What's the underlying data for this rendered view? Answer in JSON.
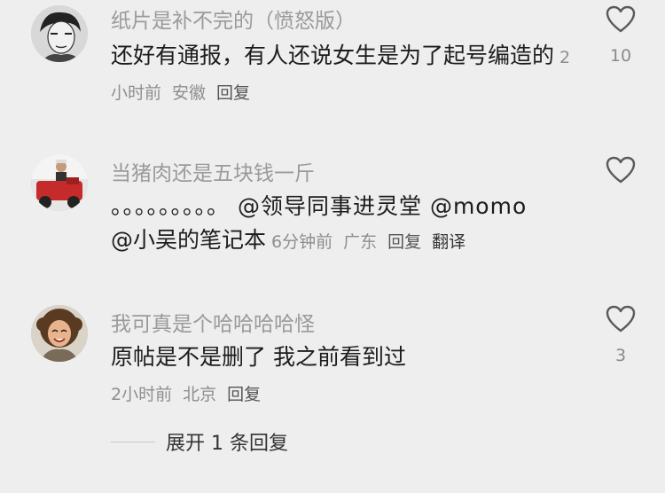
{
  "comments": [
    {
      "username": "纸片是补不完的（愤怒版）",
      "text": "还好有通报，有人还说女生是为了起号编造的",
      "time": "2小时前",
      "location": "安徽",
      "reply_label": "回复",
      "like_count": "10",
      "avatar_icon": "sketch-portrait-avatar"
    },
    {
      "username": "当猪肉还是五块钱一斤",
      "text_prefix": "。。。。。。。。。",
      "mentions": [
        "@领导同事进灵堂",
        "@momo",
        "@小吴的笔记本"
      ],
      "time": "6分钟前",
      "location": "广东",
      "reply_label": "回复",
      "translate_label": "翻译",
      "like_count": "",
      "avatar_icon": "person-with-red-motorbike-avatar"
    },
    {
      "username": "我可真是个哈哈哈哈怪",
      "text": "原帖是不是删了 我之前看到过",
      "time": "2小时前",
      "location": "北京",
      "reply_label": "回复",
      "like_count": "3",
      "avatar_icon": "curly-hair-woman-avatar"
    }
  ],
  "expand_replies": "展开 1 条回复",
  "colors": {
    "background": "#eeeeee",
    "username": "#9a9a9a",
    "meta": "#8e8e8e"
  }
}
